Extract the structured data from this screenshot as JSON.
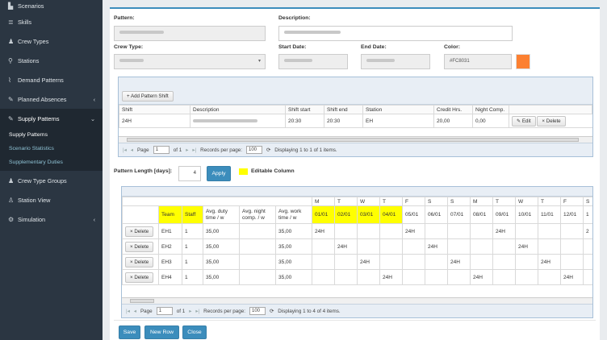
{
  "sidebar": {
    "items": [
      {
        "label": "Scenarios",
        "icon": "file-icon",
        "glyph": "▙",
        "chev": ""
      },
      {
        "label": "Skills",
        "icon": "list-icon",
        "glyph": "≣",
        "chev": ""
      },
      {
        "label": "Crew Types",
        "icon": "users-icon",
        "glyph": "♟",
        "chev": ""
      },
      {
        "label": "Stations",
        "icon": "map-marker-icon",
        "glyph": "⚲",
        "chev": ""
      },
      {
        "label": "Demand Patterns",
        "icon": "line-chart-icon",
        "glyph": "⌇",
        "chev": ""
      },
      {
        "label": "Planned Absences",
        "icon": "wrench-icon",
        "glyph": "✎",
        "chev": "‹"
      },
      {
        "label": "Supply Patterns",
        "icon": "wrench-icon",
        "glyph": "✎",
        "chev": "⌄"
      }
    ],
    "sub": [
      "Supply Patterns",
      "Scenario Statistics",
      "Supplementary Duties"
    ],
    "items2": [
      {
        "label": "Crew Type Groups",
        "icon": "users-icon",
        "glyph": "♟",
        "chev": ""
      },
      {
        "label": "Station View",
        "icon": "person-icon",
        "glyph": "♙",
        "chev": ""
      },
      {
        "label": "Simulation",
        "icon": "gear-icon",
        "glyph": "⚙",
        "chev": "‹"
      }
    ]
  },
  "form": {
    "pattern_label": "Pattern:",
    "description_label": "Description:",
    "crew_type_label": "Crew Type:",
    "start_date_label": "Start Date:",
    "end_date_label": "End Date:",
    "color_label": "Color:",
    "color_value": "#FC8031",
    "color_swatch": "#fc8031"
  },
  "shift_grid": {
    "add_button": "+ Add Pattern Shift",
    "columns": [
      "Shift",
      "Description",
      "Shift start",
      "Shift end",
      "Station",
      "Credit Hrs.",
      "Night Comp."
    ],
    "row": {
      "shift": "24H",
      "start": "20:30",
      "end": "20:30",
      "station": "EH",
      "credit": "20,00",
      "night": "0,00",
      "edit": "Edit",
      "delete": "Delete"
    },
    "pager": {
      "page": "Page",
      "page_value": "1",
      "of": "of 1",
      "records": "Records per page:",
      "per_page": "100",
      "displaying": "Displaying 1 to 1 of 1 items."
    }
  },
  "length": {
    "label": "Pattern Length [days]:",
    "value": "4",
    "apply": "Apply",
    "editable": "Editable Column"
  },
  "team_grid": {
    "days": [
      "M",
      "T",
      "W",
      "T",
      "F",
      "S",
      "S",
      "M",
      "T",
      "W",
      "T",
      "F",
      "S"
    ],
    "cols": [
      "Team",
      "Staff",
      "Avg. duty time / w",
      "Avg. night comp. / w",
      "Avg. work time / w"
    ],
    "dates": [
      "01/01",
      "02/01",
      "03/01",
      "04/01",
      "05/01",
      "06/01",
      "07/01",
      "08/01",
      "09/01",
      "10/01",
      "11/01",
      "12/01",
      "1"
    ],
    "rows": [
      {
        "team": "EH1",
        "staff": "1",
        "duty": "35,00",
        "work": "35,00",
        "cells": [
          "24H",
          "",
          "",
          "",
          "24H",
          "",
          "",
          "",
          "24H",
          "",
          "",
          "",
          "2"
        ]
      },
      {
        "team": "EH2",
        "staff": "1",
        "duty": "35,00",
        "work": "35,00",
        "cells": [
          "",
          "24H",
          "",
          "",
          "",
          "24H",
          "",
          "",
          "",
          "24H",
          "",
          "",
          ""
        ]
      },
      {
        "team": "EH3",
        "staff": "1",
        "duty": "35,00",
        "work": "35,00",
        "cells": [
          "",
          "",
          "24H",
          "",
          "",
          "",
          "24H",
          "",
          "",
          "",
          "24H",
          "",
          ""
        ]
      },
      {
        "team": "EH4",
        "staff": "1",
        "duty": "35,00",
        "work": "35,00",
        "cells": [
          "",
          "",
          "",
          "24H",
          "",
          "",
          "",
          "24H",
          "",
          "",
          "",
          "24H",
          ""
        ]
      }
    ],
    "delete": "Delete",
    "pager": {
      "page": "Page",
      "page_value": "1",
      "of": "of 1",
      "records": "Records per page:",
      "per_page": "100",
      "displaying": "Displaying 1 to 4 of 4 items."
    }
  },
  "actions": {
    "save": "Save",
    "new_row": "New Row",
    "close": "Close"
  }
}
